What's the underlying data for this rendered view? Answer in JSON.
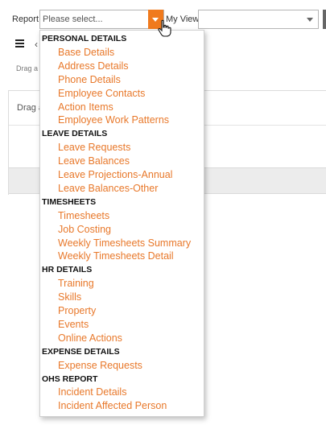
{
  "toolbar": {
    "report_label": "Report",
    "report_placeholder": "Please select...",
    "myview_label": "My View",
    "myview_value": ""
  },
  "background": {
    "drag_small": "Drag a c",
    "grid_drag_text": "Drag a"
  },
  "colors": {
    "accent": "#f07a1d",
    "option_text": "#e8782a",
    "header_text": "#111111"
  },
  "dropdown": {
    "groups": [
      {
        "header": "PERSONAL DETAILS",
        "items": [
          "Base Details",
          "Address Details",
          "Phone Details",
          "Employee Contacts",
          "Action Items",
          "Employee Work Patterns"
        ]
      },
      {
        "header": "LEAVE DETAILS",
        "items": [
          "Leave Requests",
          "Leave Balances",
          "Leave Projections-Annual",
          "Leave Balances-Other"
        ]
      },
      {
        "header": "TIMESHEETS",
        "items": [
          "Timesheets",
          "Job Costing",
          "Weekly Timesheets Summary",
          "Weekly Timesheets Detail"
        ]
      },
      {
        "header": "HR DETAILS",
        "items": [
          "Training",
          "Skills",
          "Property",
          "Events",
          "Online Actions"
        ]
      },
      {
        "header": "EXPENSE DETAILS",
        "items": [
          "Expense Requests"
        ]
      },
      {
        "header": "OHS REPORT",
        "items": [
          "Incident Details",
          "Incident Affected Person"
        ]
      }
    ]
  }
}
